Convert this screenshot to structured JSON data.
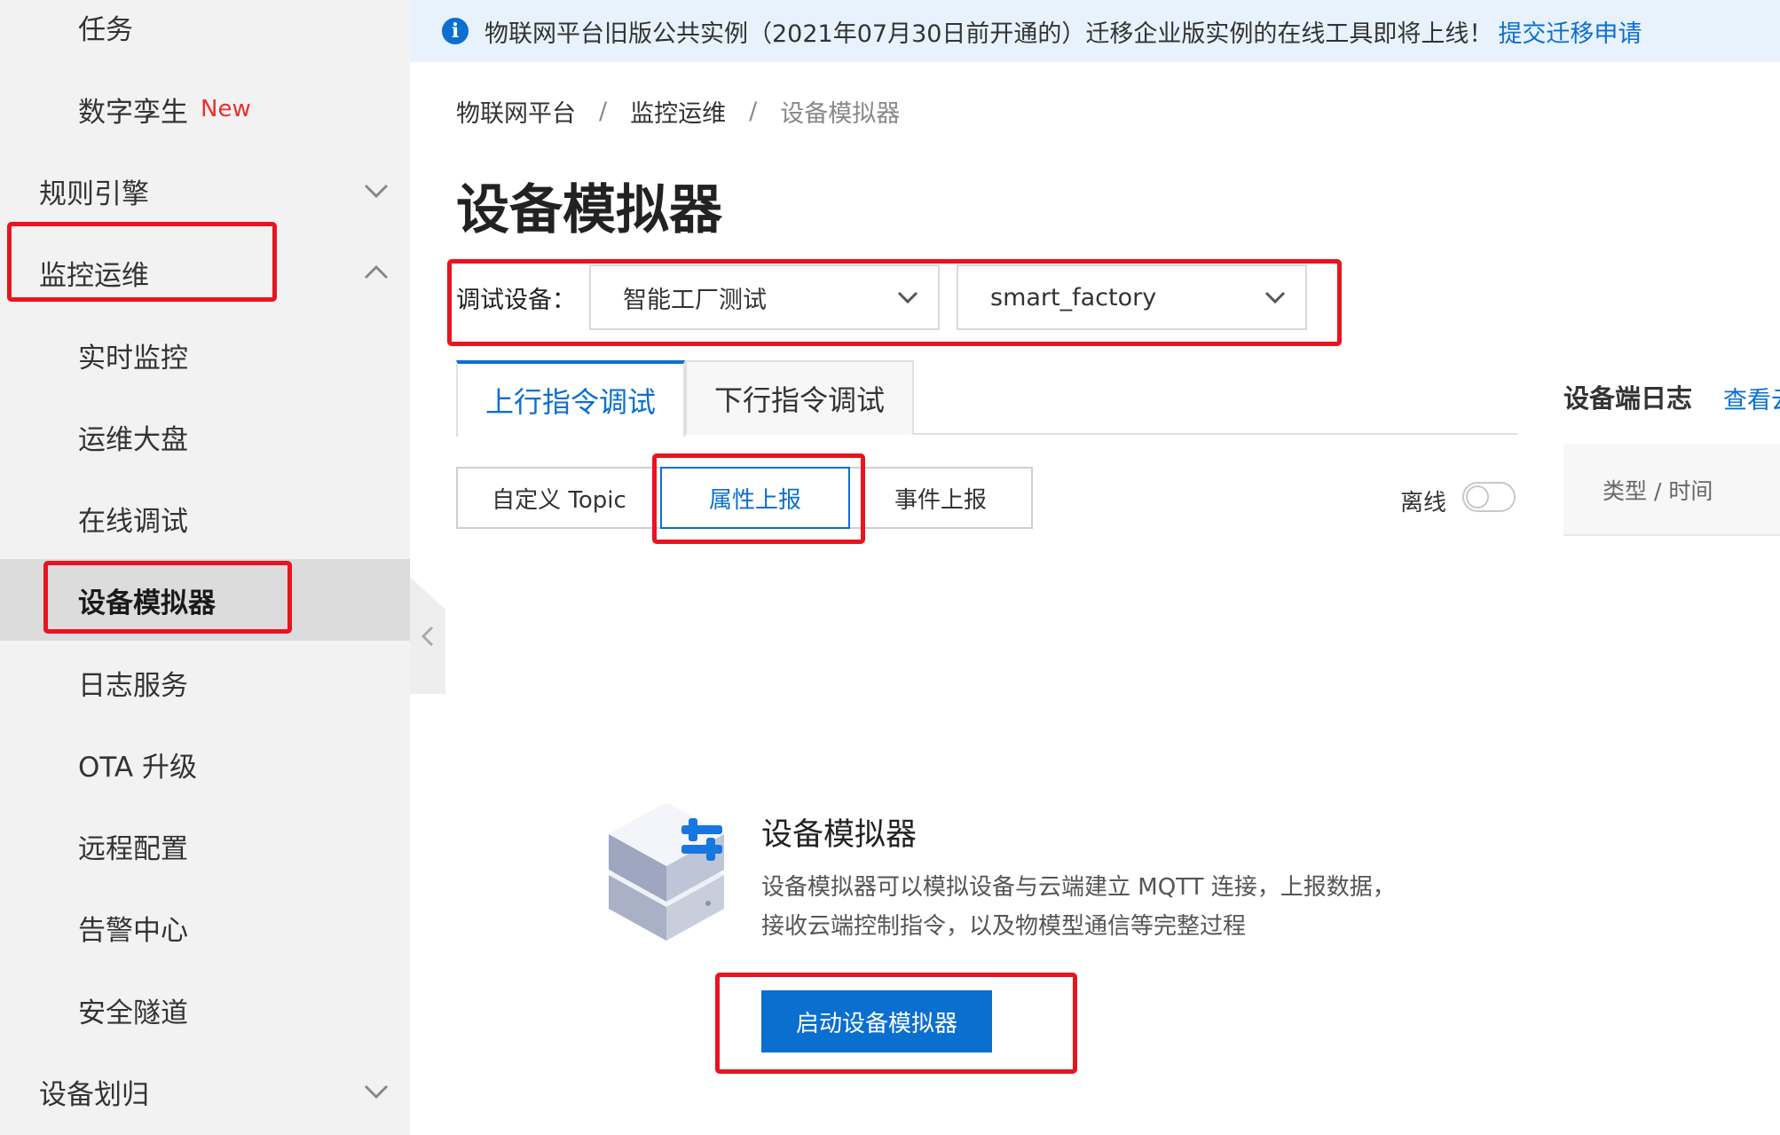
{
  "sidebar": {
    "items": [
      {
        "label": "任务",
        "type": "child"
      },
      {
        "label": "数字孪生",
        "type": "child",
        "tag": "New"
      },
      {
        "label": "规则引擎",
        "type": "parent",
        "expanded": false
      },
      {
        "label": "监控运维",
        "type": "parent",
        "expanded": true
      },
      {
        "label": "实时监控",
        "type": "child"
      },
      {
        "label": "运维大盘",
        "type": "child"
      },
      {
        "label": "在线调试",
        "type": "child"
      },
      {
        "label": "设备模拟器",
        "type": "child",
        "active": true
      },
      {
        "label": "日志服务",
        "type": "child"
      },
      {
        "label": "OTA 升级",
        "type": "child"
      },
      {
        "label": "远程配置",
        "type": "child"
      },
      {
        "label": "告警中心",
        "type": "child"
      },
      {
        "label": "安全隧道",
        "type": "child"
      },
      {
        "label": "设备划归",
        "type": "parent",
        "expanded": false
      }
    ]
  },
  "banner": {
    "icon": "info-icon",
    "icon_glyph": "i",
    "text": "物联网平台旧版公共实例（2021年07月30日前开通的）迁移企业版实例的在线工具即将上线！",
    "link": "提交迁移申请"
  },
  "breadcrumb": {
    "items": [
      "物联网平台",
      "监控运维",
      "设备模拟器"
    ],
    "separator": "/"
  },
  "page_title": "设备模拟器",
  "debug_device": {
    "label": "调试设备：",
    "product": "智能工厂测试",
    "device": "smart_factory"
  },
  "tabs": {
    "uplink": "上行指令调试",
    "downlink": "下行指令调试",
    "active": "uplink"
  },
  "sub_tabs": {
    "custom_topic": "自定义 Topic",
    "property_report": "属性上报",
    "event_report": "事件上报",
    "active": "property_report"
  },
  "offline": {
    "label": "离线",
    "on": false
  },
  "log_panel": {
    "title": "设备端日志",
    "view_link": "查看云",
    "column": "类型 / 时间"
  },
  "empty_state": {
    "icon": "device-simulator-icon",
    "title": "设备模拟器",
    "description": "设备模拟器可以模拟设备与云端建立 MQTT 连接，上报数据，接收云端控制指令，以及物模型通信等完整过程",
    "button": "启动设备模拟器"
  },
  "colors": {
    "accent": "#0b6fd0",
    "highlight": "#e8141f",
    "new_tag": "#e8312a",
    "sidebar_bg": "#f2f2f2",
    "banner_bg": "#e7f2fd"
  }
}
